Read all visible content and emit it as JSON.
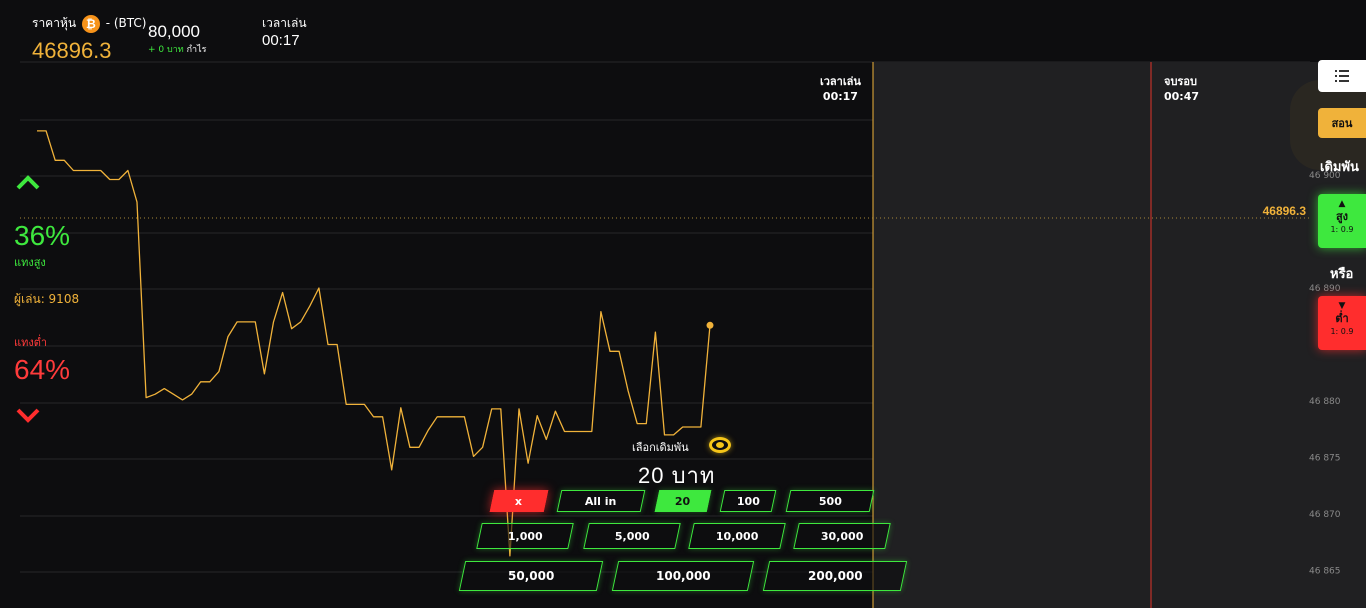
{
  "header": {
    "price_label": "ราคาหุ้น",
    "coin_symbol": "₿",
    "pair": "- (BTC)",
    "current_price": "46896.3",
    "balance": "80,000",
    "profit_amount": "+ 0 บาท",
    "profit_label": "กำไร",
    "playtime_label": "เวลาเล่น",
    "playtime_value": "00:17"
  },
  "markers": {
    "play": {
      "label": "เวลาเล่น",
      "time": "00:17"
    },
    "end": {
      "label": "จบรอบ",
      "time": "00:47"
    }
  },
  "left_panel": {
    "up_percent": "36%",
    "up_label": "แทงสูง",
    "players": "ผู้เล่น: 9108",
    "down_label": "แทงต่ำ",
    "down_percent": "64%"
  },
  "right_panel": {
    "learn_label": "สอน",
    "bet_title": "เดิมพัน",
    "up_button": {
      "label": "สูง",
      "odds": "1: 0.9"
    },
    "or_label": "หรือ",
    "down_button": {
      "label": "ต่ำ",
      "odds": "1: 0.9"
    },
    "price_tag": "46896.3"
  },
  "bet_panel": {
    "pick_label": "เลือกเดิมพัน",
    "amount": "20 บาท",
    "chips_row1": [
      "x",
      "All in",
      "20",
      "100",
      "500"
    ],
    "chips_row2": [
      "1,000",
      "5,000",
      "10,000",
      "30,000"
    ],
    "chips_row3": [
      "50,000",
      "100,000",
      "200,000"
    ],
    "selected_chip": "20"
  },
  "colors": {
    "accent_gold": "#f0b23a",
    "up_green": "#3ee83e",
    "down_red": "#ff2d2d",
    "background": "#0d0d0f"
  },
  "chart_data": {
    "type": "line",
    "y_ticks": [
      "46 900",
      "46 890",
      "46 880",
      "46 875",
      "46 870",
      "46 865"
    ],
    "values": [
      46903.9,
      46903.9,
      46901.3,
      46901.3,
      46900.4,
      46900.4,
      46900.4,
      46900.4,
      46899.6,
      46899.6,
      46900.4,
      46897.6,
      46880.3,
      46880.6,
      46881.1,
      46880.6,
      46880.1,
      46880.6,
      46881.7,
      46881.7,
      46882.6,
      46885.7,
      46887.0,
      46887.0,
      46887.0,
      46882.4,
      46887.0,
      46889.6,
      46886.4,
      46887.0,
      46888.4,
      46890.0,
      46885.0,
      46885.0,
      46879.7,
      46879.7,
      46879.7,
      46878.6,
      46878.6,
      46873.9,
      46879.4,
      46875.9,
      46875.9,
      46877.4,
      46878.6,
      46878.6,
      46878.6,
      46878.6,
      46875.1,
      46875.9,
      46879.3,
      46879.3,
      46866.3,
      46879.3,
      46874.5,
      46878.7,
      46876.6,
      46879.1,
      46877.3,
      46877.3,
      46877.3,
      46877.3,
      46887.9,
      46884.4,
      46884.4,
      46880.9,
      46878.0,
      46878.0,
      46886.1,
      46877.0,
      46877.0,
      46877.7,
      46877.7,
      46877.7,
      46886.7
    ],
    "current_price": 46896.3
  }
}
